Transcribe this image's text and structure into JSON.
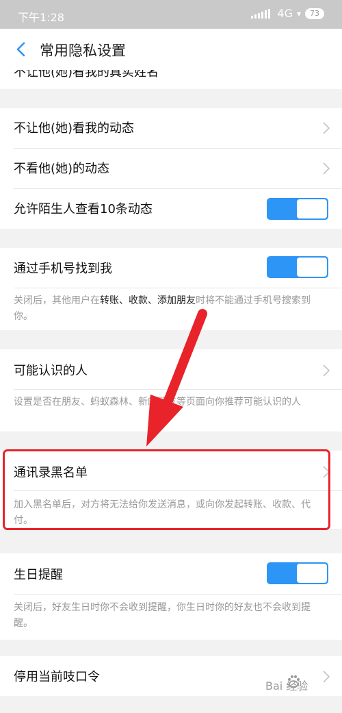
{
  "status_bar": {
    "time": "下午1:28",
    "network": "4G",
    "battery": "73"
  },
  "nav": {
    "title": "常用隐私设置",
    "back_icon": "chevron-left-icon"
  },
  "sections": {
    "top_partial": {
      "label": "不让他(她)看我的真实姓名"
    },
    "moments": {
      "items": [
        {
          "label": "不让他(她)看我的动态"
        },
        {
          "label": "不看他(她)的动态"
        },
        {
          "label": "允许陌生人查看10条动态",
          "toggle": true
        }
      ]
    },
    "phone": {
      "label": "通过手机号找到我",
      "toggle": true,
      "desc_prefix": "关闭后，其他用户在",
      "desc_highlight": "转账、收款、添加朋友",
      "desc_suffix": "时将不能通过手机号搜索到你。"
    },
    "people": {
      "label": "可能认识的人",
      "desc": "设置是否在朋友、蚂蚁森林、新的朋友等页面向你推荐可能认识的人"
    },
    "blacklist": {
      "label": "通讯录黑名单",
      "desc": "加入黑名单后，对方将无法给你发送消息，或向你发起转账、收款、代付。"
    },
    "birthday": {
      "label": "生日提醒",
      "toggle": true,
      "desc": "关闭后，好友生日时你不会收到提醒，你生日时你的好友也不会收到提醒。"
    },
    "password": {
      "label": "停用当前吱口令"
    }
  },
  "watermark": {
    "text": "Bai 经验"
  },
  "colors": {
    "accent": "#2d95f5",
    "annotation": "#e8232a",
    "desc": "#999999"
  }
}
